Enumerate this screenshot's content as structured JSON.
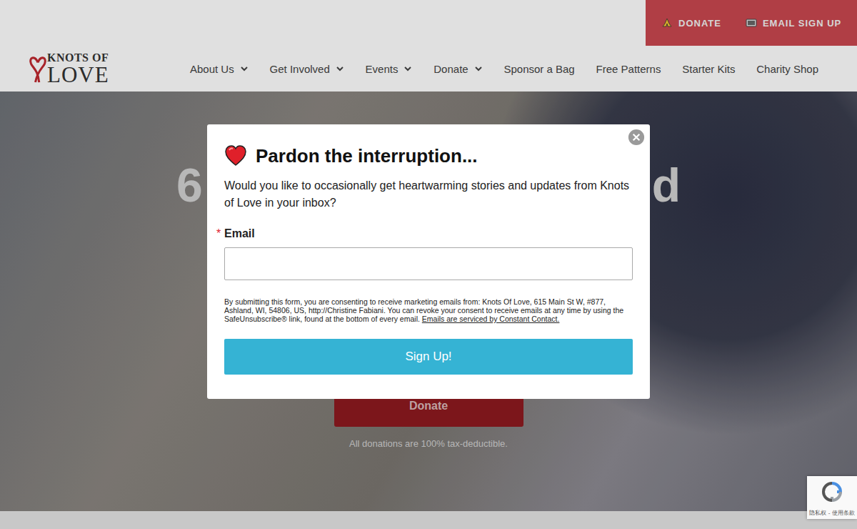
{
  "topbar": {
    "links": [
      {
        "label": "DONATE",
        "kind": "donate"
      },
      {
        "label": "EMAIL SIGN UP",
        "kind": "email"
      }
    ]
  },
  "logo": {
    "top": "KNOTS OF",
    "bottom": "LOVE"
  },
  "nav": [
    {
      "label": "About Us",
      "dropdown": true
    },
    {
      "label": "Get Involved",
      "dropdown": true
    },
    {
      "label": "Events",
      "dropdown": true
    },
    {
      "label": "Donate",
      "dropdown": true
    },
    {
      "label": "Sponsor a Bag",
      "dropdown": false
    },
    {
      "label": "Free Patterns",
      "dropdown": false
    },
    {
      "label": "Starter Kits",
      "dropdown": false
    },
    {
      "label": "Charity Shop",
      "dropdown": false
    }
  ],
  "hero": {
    "heading_fragments": [
      "6",
      "d"
    ],
    "button": "Donate",
    "note": "All donations are 100% tax-deductible."
  },
  "modal": {
    "title": "Pardon the interruption...",
    "message": "Would you like to occasionally get heartwarming stories and updates from Knots of Love in your inbox?",
    "field": {
      "label": "Email",
      "required_mark": "*",
      "required": true,
      "value": ""
    },
    "consent": "By submitting this form, you are consenting to receive marketing emails from: Knots Of Love, 615 Main St W, #877, Ashland, WI, 54806, US, http://Christine Fabiani. You can revoke your consent to receive emails at any time by using the SafeUnsubscribe® link, found at the bottom of every email.",
    "consent_link": "Emails are serviced by Constant Contact.",
    "submit": "Sign Up!"
  },
  "recaptcha": {
    "links": "隐私权 - 使用条款"
  }
}
